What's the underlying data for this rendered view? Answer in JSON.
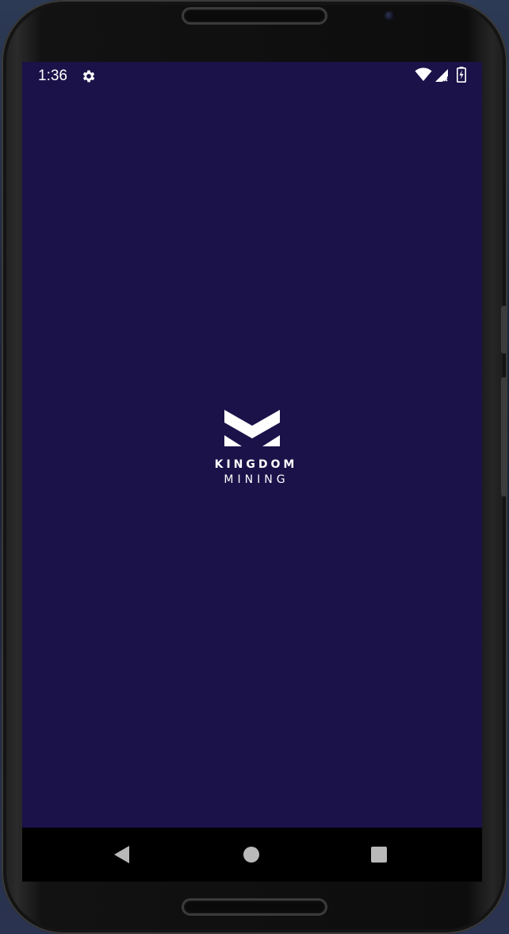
{
  "status_bar": {
    "time": "1:36",
    "icons": [
      "settings-icon",
      "wifi-icon",
      "signal-icon",
      "battery-icon"
    ]
  },
  "splash": {
    "logo_icon": "kingdom-mining-logo-mark",
    "logo_line_1": "KINGDOM",
    "logo_line_2": "MINING"
  },
  "navigation": {
    "buttons": [
      "back",
      "home",
      "recents"
    ]
  },
  "colors": {
    "screen_background": "#1a1249",
    "logo": "#ffffff",
    "nav_bar": "#000000",
    "nav_icons": "#b9b9b9"
  }
}
